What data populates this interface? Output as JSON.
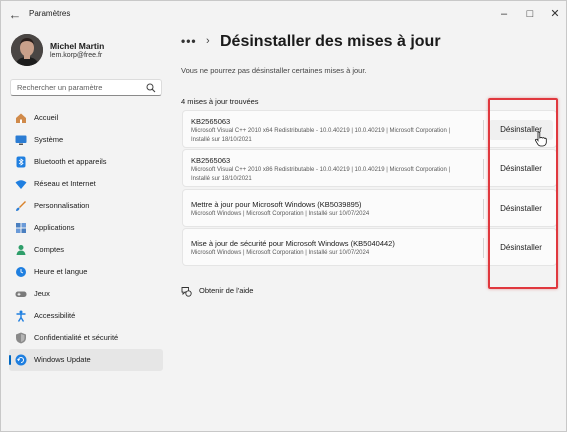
{
  "window": {
    "title": "Paramètres",
    "back_icon": "arrow-left-icon",
    "controls": [
      "minimize-icon",
      "maximize-icon",
      "close-icon"
    ]
  },
  "user": {
    "name": "Michel Martin",
    "email": "lem.korp@free.fr"
  },
  "search": {
    "placeholder": "Rechercher un paramètre",
    "value": ""
  },
  "sidebar": {
    "items": [
      {
        "label": "Accueil",
        "icon": "home-icon",
        "color": "#d08a4a"
      },
      {
        "label": "Système",
        "icon": "monitor-icon",
        "color": "#2b7cd3"
      },
      {
        "label": "Bluetooth et appareils",
        "icon": "bluetooth-icon",
        "color": "#1f7fe0"
      },
      {
        "label": "Réseau et Internet",
        "icon": "wifi-icon",
        "color": "#1f7fe0"
      },
      {
        "label": "Personnalisation",
        "icon": "brush-icon",
        "color": "#d9822b"
      },
      {
        "label": "Applications",
        "icon": "apps-icon",
        "color": "#4a7fc0"
      },
      {
        "label": "Comptes",
        "icon": "person-icon",
        "color": "#2f9e6a"
      },
      {
        "label": "Heure et langue",
        "icon": "globe-clock-icon",
        "color": "#1f7fe0"
      },
      {
        "label": "Jeux",
        "icon": "gamepad-icon",
        "color": "#7a7a7a"
      },
      {
        "label": "Accessibilité",
        "icon": "accessibility-icon",
        "color": "#1f7fe0"
      },
      {
        "label": "Confidentialité et sécurité",
        "icon": "shield-icon",
        "color": "#8a8a8a"
      },
      {
        "label": "Windows Update",
        "icon": "update-icon",
        "color": "#1f7fe0",
        "active": true
      }
    ]
  },
  "main": {
    "breadcrumb_more": "•••",
    "title": "Désinstaller des mises à jour",
    "subtitle": "Vous ne pourrez pas désinstaller certaines mises à jour.",
    "count_label": "4 mises à jour trouvées",
    "updates": [
      {
        "name": "KB2565063",
        "details": "Microsoft Visual C++ 2010  x64 Redistributable - 10.0.40219   |   10.0.40219   |   Microsoft Corporation   |",
        "date": "Installé sur 18/10/2021",
        "button": "Désinstaller"
      },
      {
        "name": "KB2565063",
        "details": "Microsoft Visual C++ 2010  x86 Redistributable - 10.0.40219   |   10.0.40219   |   Microsoft Corporation   |",
        "date": "Installé sur 18/10/2021",
        "button": "Désinstaller"
      },
      {
        "name": "Mettre à jour pour Microsoft Windows (KB5039895)",
        "details": "Microsoft Windows   |   Microsoft Corporation   |   Installé sur 10/07/2024",
        "date": "",
        "button": "Désinstaller"
      },
      {
        "name": "Mise à jour de sécurité pour Microsoft Windows (KB5040442)",
        "details": "Microsoft Windows   |   Microsoft Corporation   |   Installé sur 10/07/2024",
        "date": "",
        "button": "Désinstaller"
      }
    ],
    "help": {
      "label": "Obtenir de l'aide",
      "icon": "help-chat-icon"
    }
  },
  "colors": {
    "accent": "#0067c0",
    "highlight_box": "#e0383e",
    "background": "#f3f3f3"
  }
}
